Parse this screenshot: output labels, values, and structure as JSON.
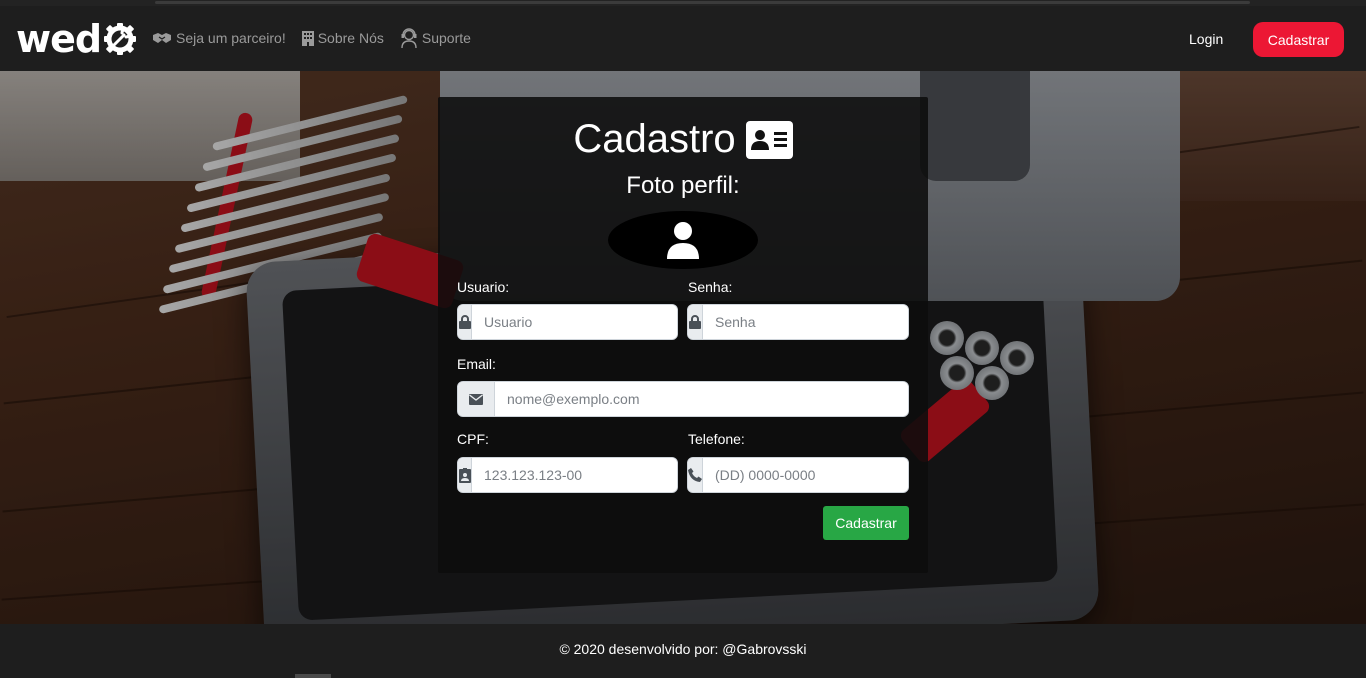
{
  "brand": {
    "name": "wed",
    "logo_icon": "gear-wrench-icon"
  },
  "nav": {
    "links": [
      {
        "label": "Seja um parceiro!",
        "icon": "handshake-icon"
      },
      {
        "label": "Sobre Nós",
        "icon": "building-icon"
      },
      {
        "label": "Suporte",
        "icon": "support-agent-icon"
      }
    ],
    "login_label": "Login",
    "signup_label": "Cadastrar"
  },
  "form": {
    "title": "Cadastro",
    "title_icon": "id-card-icon",
    "photo_label": "Foto perfil:",
    "avatar_icon": "user-icon",
    "fields": {
      "usuario": {
        "label": "Usuario:",
        "placeholder": "Usuario",
        "icon": "lock-icon"
      },
      "senha": {
        "label": "Senha:",
        "placeholder": "Senha",
        "icon": "lock-icon"
      },
      "email": {
        "label": "Email:",
        "placeholder": "nome@exemplo.com",
        "icon": "envelope-icon"
      },
      "cpf": {
        "label": "CPF:",
        "placeholder": "123.123.123-00",
        "icon": "id-badge-icon"
      },
      "telefone": {
        "label": "Telefone:",
        "placeholder": "(DD) 0000-0000",
        "icon": "phone-icon"
      }
    },
    "submit_label": "Cadastrar"
  },
  "footer": {
    "text": "© 2020 desenvolvido por: @Gabrovsski"
  },
  "colors": {
    "accent_red": "#ec1734",
    "submit_green": "#28a745",
    "navbar": "#1e1e1e"
  }
}
